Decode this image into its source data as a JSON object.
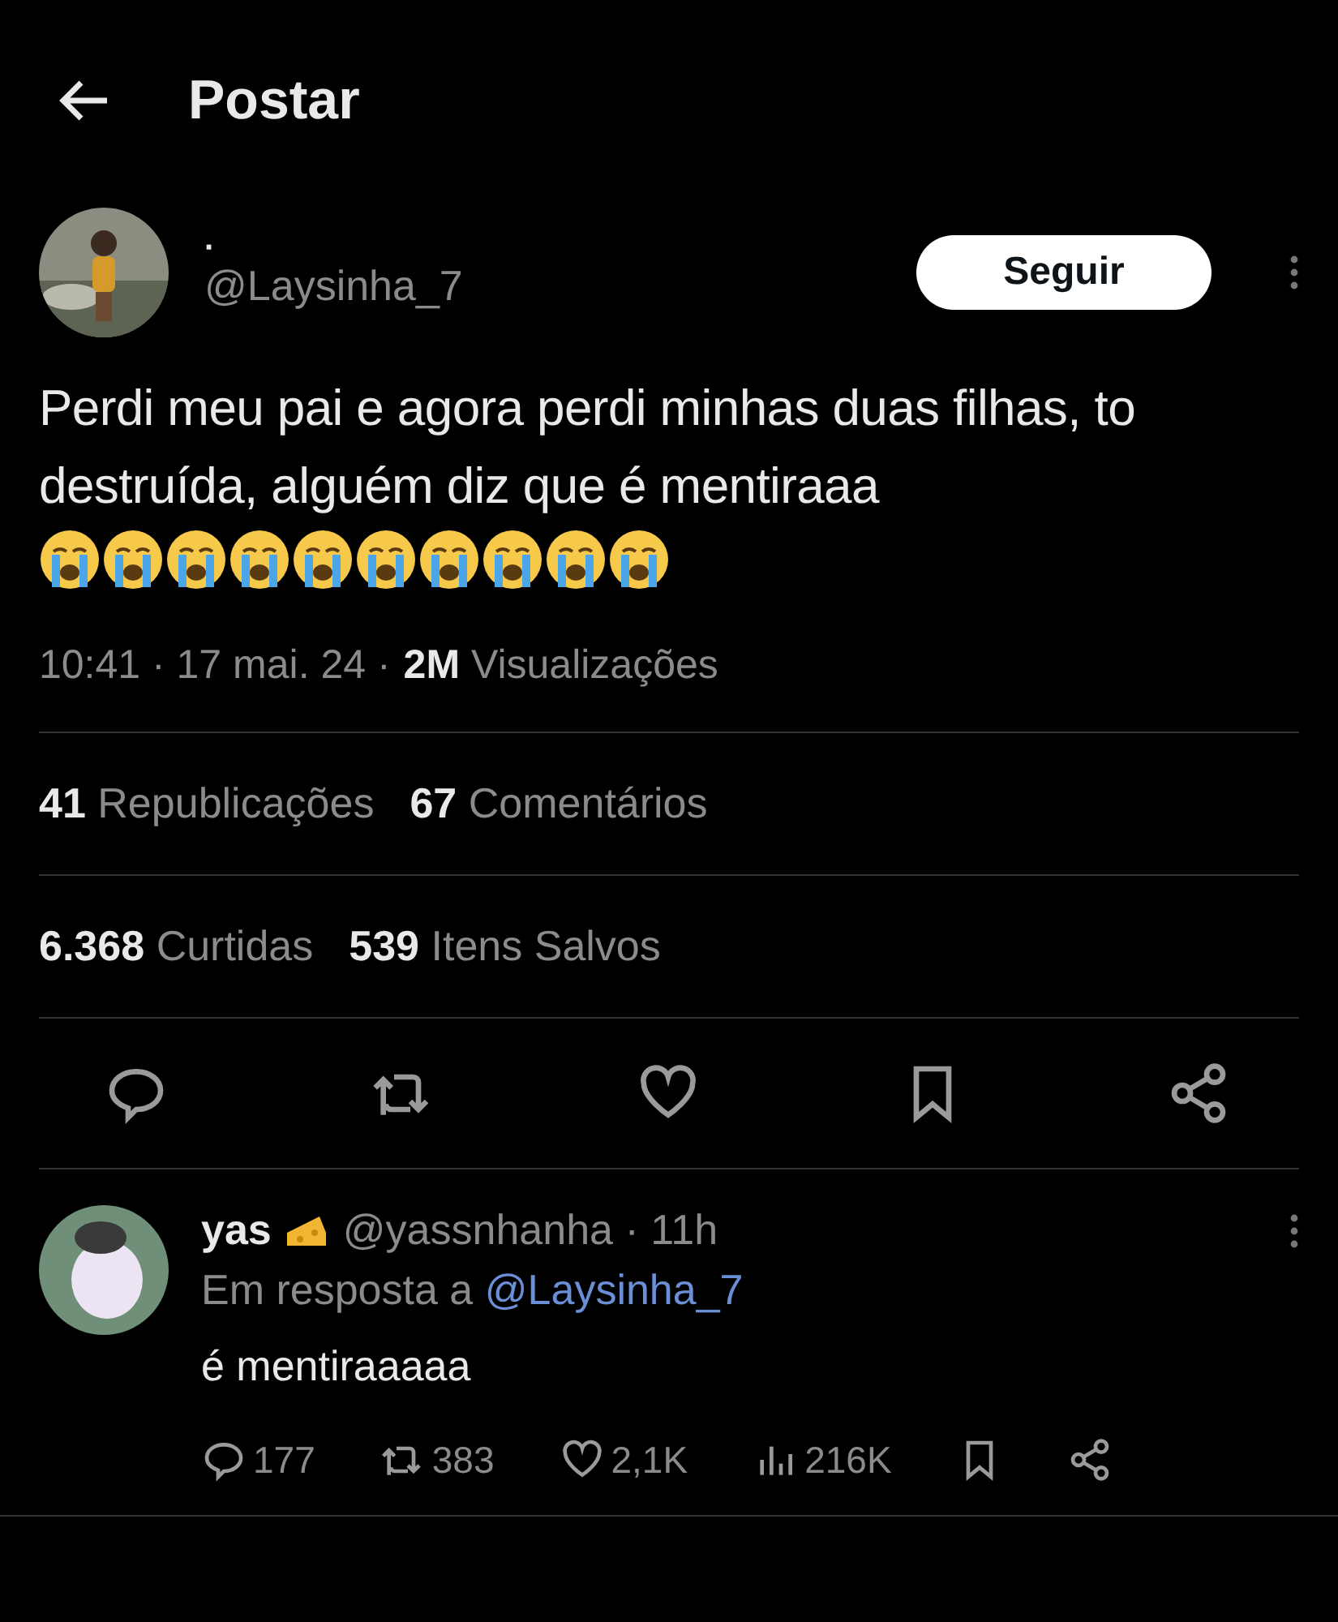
{
  "header": {
    "title": "Postar"
  },
  "post": {
    "name": "·",
    "handle": "@Laysinha_7",
    "follow_label": "Seguir",
    "text": "Perdi meu pai e agora perdi minhas duas filhas, to destruída, alguém diz que é mentiraaa",
    "time": "10:41 · 17 mai. 24 ·",
    "views_count": "2M",
    "views_label": "Visualizações",
    "stats": [
      [
        {
          "count": "41",
          "label": "Republicações"
        },
        {
          "count": "67",
          "label": "Comentários"
        }
      ],
      [
        {
          "count": "6.368",
          "label": "Curtidas"
        },
        {
          "count": "539",
          "label": "Itens Salvos"
        }
      ]
    ]
  },
  "reply": {
    "name": "yas",
    "handle": "@yassnhanha · 11h",
    "reply_prefix": "Em resposta a",
    "reply_to": "@Laysinha_7",
    "text": "é mentiraaaaa",
    "actions": [
      {
        "kind": "reply",
        "count": "177"
      },
      {
        "kind": "repost",
        "count": "383"
      },
      {
        "kind": "like",
        "count": "2,1K"
      },
      {
        "kind": "views",
        "count": "216K"
      },
      {
        "kind": "bookmark"
      },
      {
        "kind": "share"
      }
    ]
  }
}
